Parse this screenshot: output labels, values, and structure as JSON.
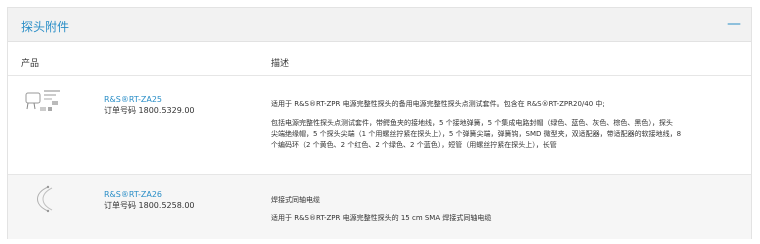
{
  "panel": {
    "title": "探头附件",
    "collapse_symbol": "—",
    "columns": {
      "product": "产品",
      "description": "描述"
    }
  },
  "products": [
    {
      "name": "R&S®RT-ZA25",
      "order_label": "订单号码 1800.5329.00",
      "icon": "probe-accessory-set-icon",
      "description_lines": [
        "适用于 R&S®RT-ZPR 电源完整性探头的备用电源完整性探头点测试套件。包含在 R&S®RT-ZPR20/40 中;",
        "包括电源完整性探头点测试套件，带鳄鱼夹的接地线，5 个接地弹簧，5 个集成电路封帽（绿色、蓝色、灰色、棕色、黑色），探头",
        "尖端绝缘帽，5 个探头尖端（1 个用螺丝拧紧在探头上），5 个弹簧尖端，弹簧钩，SMD 微型夹，双适配器，带适配器的软接地线，8",
        "个编码环（2 个黄色、2 个红色、2 个绿色、2 个蓝色），短管（用螺丝拧紧在探头上），长管"
      ]
    },
    {
      "name": "R&S®RT-ZA26",
      "order_label": "订单号码 1800.5258.00",
      "icon": "coax-cable-icon",
      "description_lines": [
        "焊接式同轴电缆",
        "适用于 R&S®RT-ZPR 电源完整性探头的 15 cm SMA 焊接式同轴电缆"
      ]
    }
  ]
}
